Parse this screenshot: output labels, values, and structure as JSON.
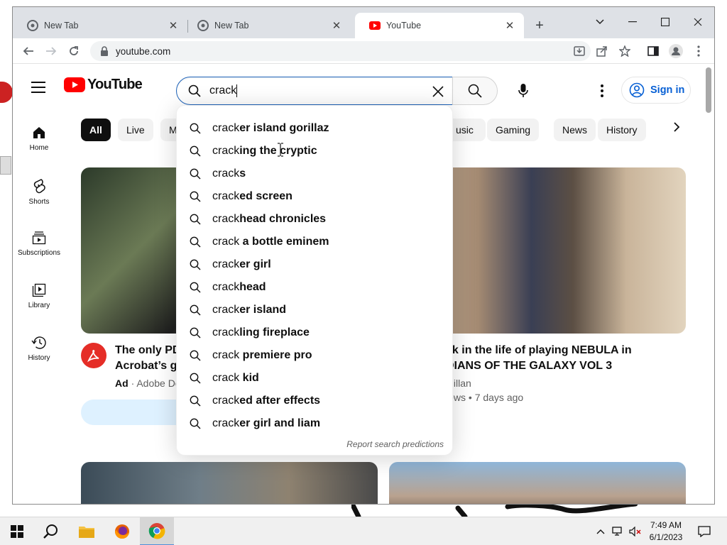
{
  "browser": {
    "tabs": [
      {
        "title": "New Tab",
        "close": "✕"
      },
      {
        "title": "New Tab",
        "close": "✕"
      },
      {
        "title": "YouTube",
        "close": "✕"
      }
    ],
    "new_tab": "+",
    "address": "youtube.com"
  },
  "youtube": {
    "logo_text": "YouTube",
    "search_query": "crack",
    "sign_in": "Sign in",
    "guide": [
      {
        "label": "Home",
        "icon": "home-icon"
      },
      {
        "label": "Shorts",
        "icon": "shorts-icon"
      },
      {
        "label": "Subscriptions",
        "icon": "subscriptions-icon"
      },
      {
        "label": "Library",
        "icon": "library-icon"
      },
      {
        "label": "History",
        "icon": "history-icon"
      }
    ],
    "chips": [
      "All",
      "Live",
      "M",
      "usic",
      "Gaming",
      "News",
      "History"
    ],
    "suggestions": [
      {
        "prefix": "crack",
        "rest": "er island gorillaz"
      },
      {
        "prefix": "crack",
        "rest": "ing the cryptic"
      },
      {
        "prefix": "crack",
        "rest": "s"
      },
      {
        "prefix": "crack",
        "rest": "ed screen"
      },
      {
        "prefix": "crack",
        "rest": "head chronicles"
      },
      {
        "prefix": "crack",
        "rest": " a bottle eminem"
      },
      {
        "prefix": "crack",
        "rest": "er girl"
      },
      {
        "prefix": "crack",
        "rest": "head"
      },
      {
        "prefix": "crack",
        "rest": "er island"
      },
      {
        "prefix": "crack",
        "rest": "ling fireplace"
      },
      {
        "prefix": "crack",
        "rest": " premiere pro"
      },
      {
        "prefix": "crack",
        "rest": " kid"
      },
      {
        "prefix": "crack",
        "rest": "ed after effects"
      },
      {
        "prefix": "crack",
        "rest": "er girl and liam"
      }
    ],
    "report_predictions": "Report search predictions",
    "video1": {
      "title_line1": "The only PD",
      "title_line2": "Acrobat’s go",
      "ad_label": "Ad",
      "channel": "· Adobe Do"
    },
    "video2": {
      "title_line1": "ek in the life of playing NEBULA in",
      "title_line2": "DIANS OF THE GALAXY VOL 3",
      "channel": "Gillan",
      "meta": "iews • 7 days ago"
    }
  },
  "taskbar": {
    "time": "7:49 AM",
    "date": "6/1/2023"
  },
  "colors": {
    "yt_red": "#ff0000",
    "link_blue": "#065fd4",
    "search_focus": "#1c62b9"
  }
}
